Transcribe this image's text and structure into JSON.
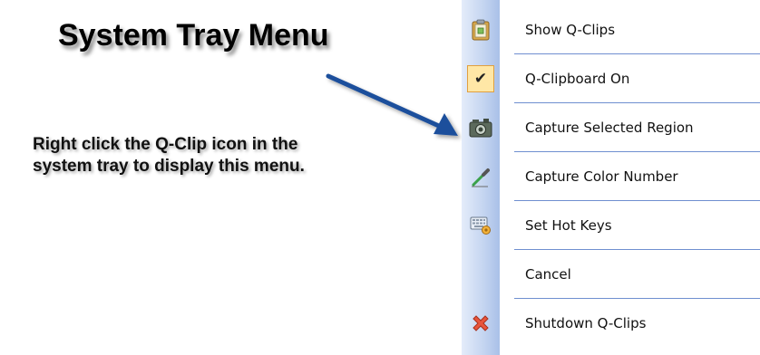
{
  "heading": "System Tray Menu",
  "description": {
    "line1": "Right click the Q-Clip icon in the",
    "line2": "system tray to display this menu."
  },
  "menu": {
    "items": [
      {
        "label": "Show Q-Clips",
        "icon": "clipboard-icon"
      },
      {
        "label": "Q-Clipboard On",
        "icon": "checkmark-icon",
        "checked": true
      },
      {
        "label": "Capture Selected Region",
        "icon": "camera-icon"
      },
      {
        "label": "Capture Color Number",
        "icon": "eyedropper-icon"
      },
      {
        "label": "Set Hot Keys",
        "icon": "keyboard-icon"
      },
      {
        "label": "Cancel",
        "icon": ""
      },
      {
        "label": "Shutdown Q-Clips",
        "icon": "close-x-icon"
      }
    ]
  },
  "colors": {
    "arrow": "#1f4f9c",
    "separator": "#6f8fd0",
    "checked_background": "#ffe7a6",
    "shutdown_icon": "#e8553c"
  }
}
